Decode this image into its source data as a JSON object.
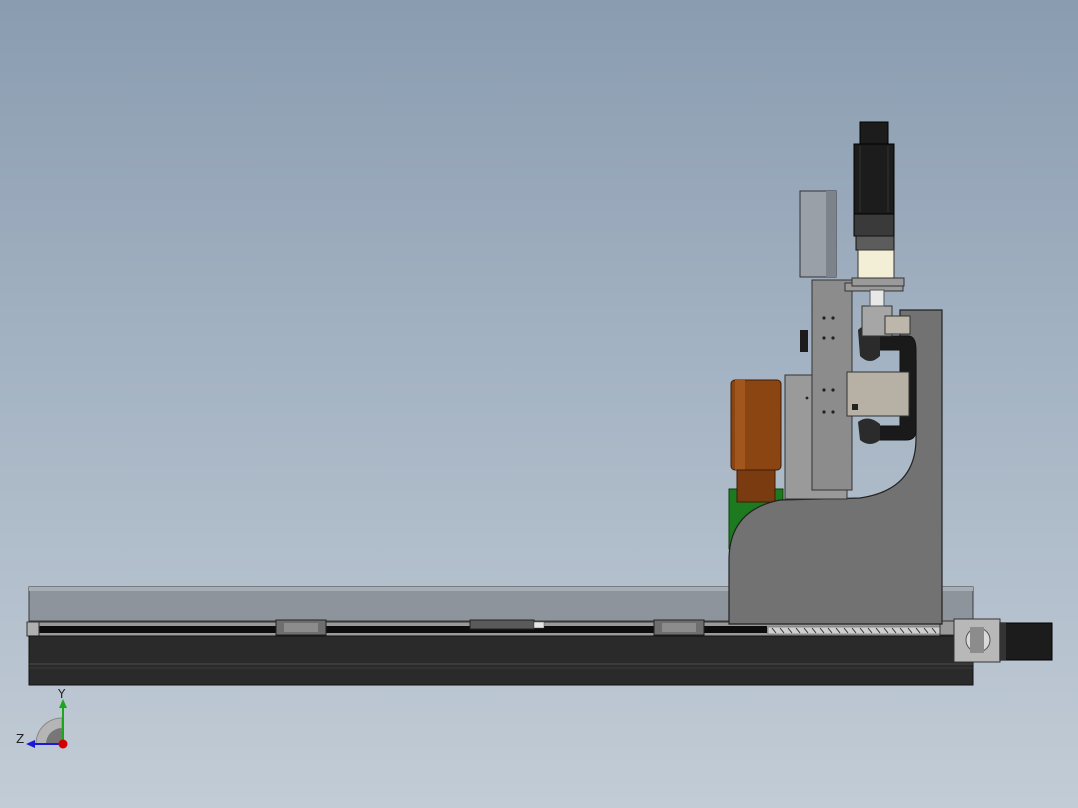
{
  "viewport": {
    "background_top": "#8a9cb0",
    "background_bottom": "#c2ccd6"
  },
  "triad": {
    "y_label": "Y",
    "z_label": "Z",
    "y_color": "#1aa81a",
    "z_color": "#1a1ad6",
    "x_color": "#d40000"
  },
  "model": {
    "base_color": "#2a2a2a",
    "cover_color": "#8d949c",
    "frame_color": "#727272",
    "plate_color": "#9a9a9a",
    "motor_color": "#1c1c1c",
    "cylinder_color": "#8b4513",
    "green_part_color": "#1e7a1e"
  }
}
